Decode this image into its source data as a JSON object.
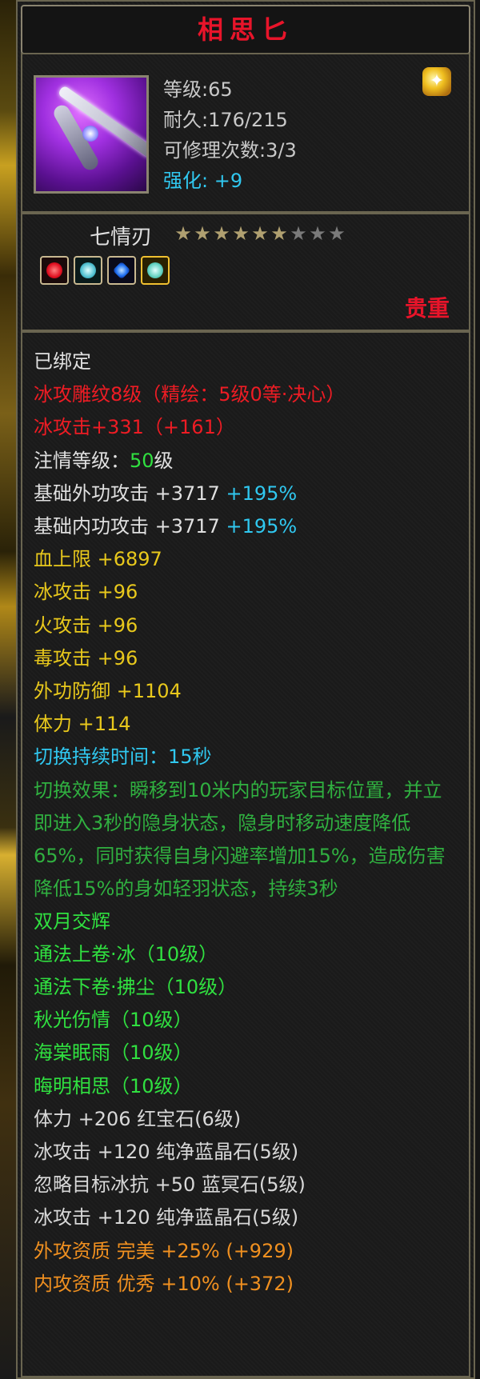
{
  "item": {
    "name": "相思匕",
    "level_label": "等级:65",
    "durability_label": "耐久:176/215",
    "repair_label": "可修理次数:3/3",
    "enhance_label": "强化:",
    "enhance_value": "+9",
    "set_name": "七情刃",
    "stars_total": 9,
    "stars_lit": 6,
    "rarity": "贵重",
    "icon": "dagger-icon",
    "socket_gems": [
      "ruby-gem-icon",
      "jade-gem-icon",
      "sapphire-gem-icon",
      "jade-gem-gold-icon"
    ]
  },
  "lines": [
    {
      "parts": [
        {
          "t": "已绑定",
          "c": "c-white"
        }
      ]
    },
    {
      "parts": [
        {
          "t": "冰攻雕纹8级（精绘：5级0等·决心）",
          "c": "c-red"
        }
      ]
    },
    {
      "parts": [
        {
          "t": "冰攻击+331（+161）",
          "c": "c-red"
        }
      ]
    },
    {
      "parts": [
        {
          "t": "注情等级：",
          "c": "c-white"
        },
        {
          "t": "50",
          "c": "c-green"
        },
        {
          "t": "级",
          "c": "c-white"
        }
      ]
    },
    {
      "parts": [
        {
          "t": "基础外功攻击 +3717 ",
          "c": "c-white"
        },
        {
          "t": "+195%",
          "c": "c-cyan"
        }
      ]
    },
    {
      "parts": [
        {
          "t": "基础内功攻击 +3717 ",
          "c": "c-white"
        },
        {
          "t": "+195%",
          "c": "c-cyan"
        }
      ]
    },
    {
      "parts": [
        {
          "t": "血上限 +6897",
          "c": "c-yellow"
        }
      ]
    },
    {
      "parts": [
        {
          "t": "冰攻击 +96",
          "c": "c-yellow"
        }
      ]
    },
    {
      "parts": [
        {
          "t": "火攻击 +96",
          "c": "c-yellow"
        }
      ]
    },
    {
      "parts": [
        {
          "t": "毒攻击 +96",
          "c": "c-yellow"
        }
      ]
    },
    {
      "parts": [
        {
          "t": "外功防御 +1104",
          "c": "c-yellow"
        }
      ]
    },
    {
      "parts": [
        {
          "t": "体力 +114",
          "c": "c-yellow"
        }
      ]
    },
    {
      "parts": [
        {
          "t": "切换持续时间：15秒",
          "c": "c-cyan"
        }
      ]
    }
  ],
  "switch_effect": "切换效果：瞬移到10米内的玩家目标位置，并立即进入3秒的隐身状态，隐身时移动速度降低65%，同时获得自身闪避率增加15%，造成伤害降低15%的身如轻羽状态，持续3秒",
  "lines2": [
    {
      "parts": [
        {
          "t": "双月交辉",
          "c": "c-green"
        }
      ]
    },
    {
      "parts": [
        {
          "t": "通法上卷·冰（10级）",
          "c": "c-green"
        }
      ]
    },
    {
      "parts": [
        {
          "t": "通法下卷·拂尘（10级）",
          "c": "c-green"
        }
      ]
    },
    {
      "parts": [
        {
          "t": "秋光伤情（10级）",
          "c": "c-green"
        }
      ]
    },
    {
      "parts": [
        {
          "t": "海棠眠雨（10级）",
          "c": "c-green"
        }
      ]
    },
    {
      "parts": [
        {
          "t": "晦明相思（10级）",
          "c": "c-green"
        }
      ]
    },
    {
      "parts": [
        {
          "t": "体力 +206 红宝石(6级)",
          "c": "c-grey"
        }
      ]
    },
    {
      "parts": [
        {
          "t": "冰攻击 +120 纯净蓝晶石(5级)",
          "c": "c-grey"
        }
      ]
    },
    {
      "parts": [
        {
          "t": "忽略目标冰抗 +50 蓝冥石(5级)",
          "c": "c-grey"
        }
      ]
    },
    {
      "parts": [
        {
          "t": "冰攻击 +120 纯净蓝晶石(5级)",
          "c": "c-grey"
        }
      ]
    },
    {
      "parts": [
        {
          "t": "外攻资质  完美 +25% (+929)",
          "c": "c-orange"
        }
      ]
    },
    {
      "parts": [
        {
          "t": "内攻资质  优秀 +10% (+372)",
          "c": "c-orange"
        }
      ]
    }
  ]
}
